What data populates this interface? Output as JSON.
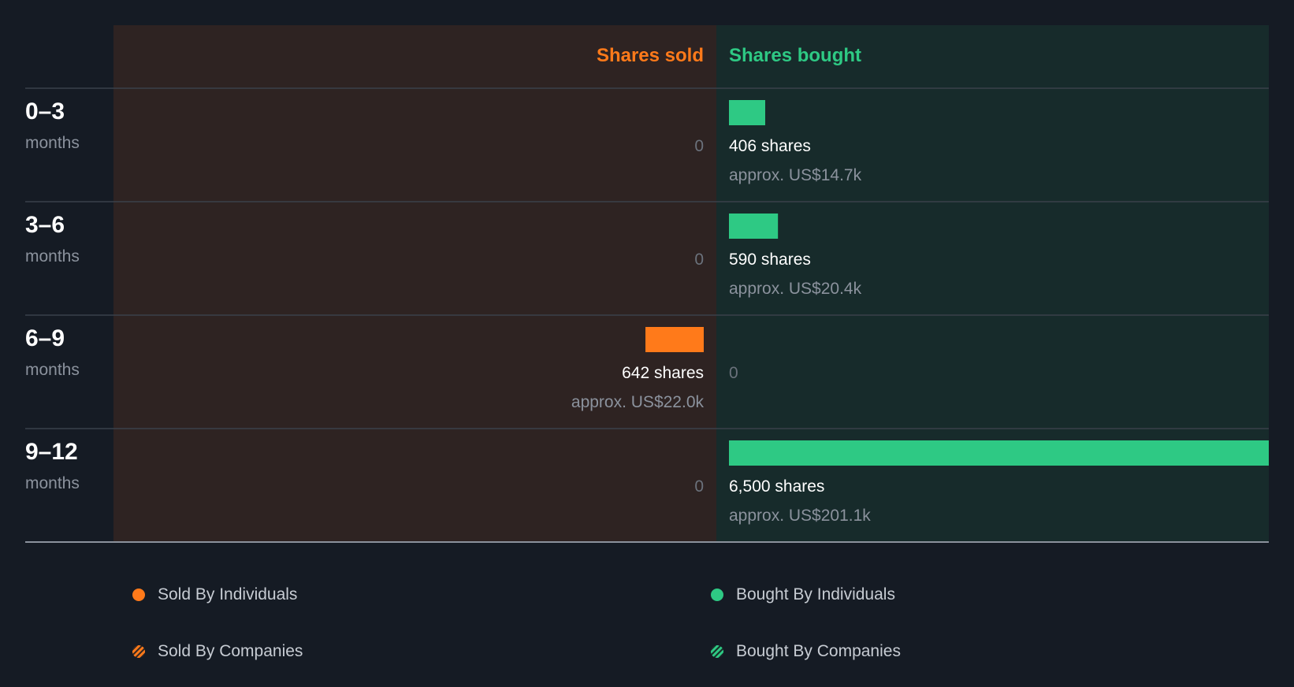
{
  "colors": {
    "background": "#151b24",
    "sold_panel": "#2e2322",
    "bought_panel": "#172b2b",
    "sold": "#ff7a1a",
    "bought": "#2ec984",
    "divider": "#3a414b",
    "baseline": "#8b929d"
  },
  "chart_data": {
    "type": "bar",
    "orientation": "horizontal-diverging",
    "headers": {
      "sold": "Shares sold",
      "bought": "Shares bought"
    },
    "categories": [
      {
        "main": "0–3",
        "sub": "months"
      },
      {
        "main": "3–6",
        "sub": "months"
      },
      {
        "main": "6–9",
        "sub": "months"
      },
      {
        "main": "9–12",
        "sub": "months"
      }
    ],
    "max_value": 6500,
    "series": [
      {
        "name": "Shares sold",
        "values": [
          0,
          0,
          642,
          0
        ],
        "labels": [
          "0",
          "0",
          "642 shares",
          "0"
        ],
        "approx": [
          "",
          "",
          "approx. US$22.0k",
          ""
        ]
      },
      {
        "name": "Shares bought",
        "values": [
          406,
          590,
          0,
          6500
        ],
        "labels": [
          "406 shares",
          "590 shares",
          "0",
          "6,500 shares"
        ],
        "approx": [
          "approx. US$14.7k",
          "approx. US$20.4k",
          "",
          "approx. US$201.1k"
        ]
      }
    ]
  },
  "legend": {
    "sold_individuals": "Sold By Individuals",
    "bought_individuals": "Bought By Individuals",
    "sold_companies": "Sold By Companies",
    "bought_companies": "Bought By Companies"
  }
}
